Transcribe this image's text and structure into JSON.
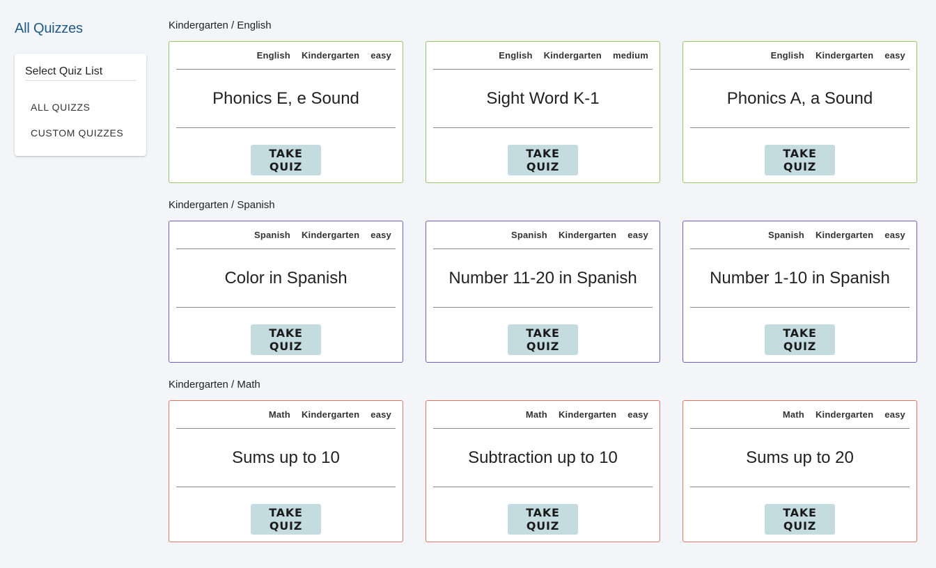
{
  "sidebar": {
    "title": "All Quizzes",
    "heading": "Select Quiz List",
    "links": [
      "ALL QUIZZS",
      "CUSTOM QUIZZES"
    ]
  },
  "groups": [
    {
      "title": "Kindergarten / English",
      "cards": [
        {
          "subject": "English",
          "grade": "Kindergarten",
          "level": "easy",
          "title": "Phonics E, e Sound",
          "button": "TAKE QUIZ"
        },
        {
          "subject": "English",
          "grade": "Kindergarten",
          "level": "medium",
          "title": "Sight Word K-1",
          "button": "TAKE QUIZ"
        },
        {
          "subject": "English",
          "grade": "Kindergarten",
          "level": "easy",
          "title": "Phonics A, a Sound",
          "button": "TAKE QUIZ"
        }
      ]
    },
    {
      "title": "Kindergarten / Spanish",
      "cards": [
        {
          "subject": "Spanish",
          "grade": "Kindergarten",
          "level": "easy",
          "title": "Color in Spanish",
          "button": "TAKE QUIZ"
        },
        {
          "subject": "Spanish",
          "grade": "Kindergarten",
          "level": "easy",
          "title": "Number 11-20 in Spanish",
          "button": "TAKE QUIZ"
        },
        {
          "subject": "Spanish",
          "grade": "Kindergarten",
          "level": "easy",
          "title": "Number 1-10 in Spanish",
          "button": "TAKE QUIZ"
        }
      ]
    },
    {
      "title": "Kindergarten / Math",
      "cards": [
        {
          "subject": "Math",
          "grade": "Kindergarten",
          "level": "easy",
          "title": "Sums up to 10",
          "button": "TAKE QUIZ"
        },
        {
          "subject": "Math",
          "grade": "Kindergarten",
          "level": "easy",
          "title": "Subtraction up to 10",
          "button": "TAKE QUIZ"
        },
        {
          "subject": "Math",
          "grade": "Kindergarten",
          "level": "easy",
          "title": "Sums up to 20",
          "button": "TAKE QUIZ"
        }
      ]
    }
  ],
  "colors": {
    "english_border": "#9cc26a",
    "spanish_border": "#6a5fc9",
    "math_border": "#e07566",
    "button_bg": "#c4dce0",
    "sidebar_title": "#1d5a86"
  }
}
